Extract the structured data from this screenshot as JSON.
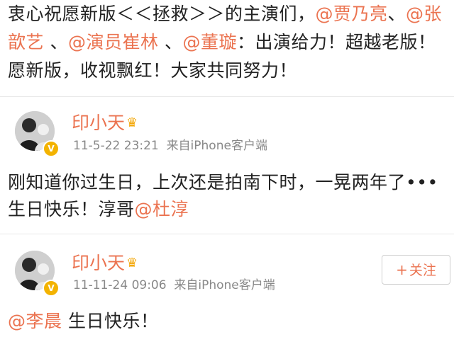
{
  "post_text": {
    "l1_prefix": "衷心祝愿新版＜＜拯救＞＞的主演们，",
    "l1_m1": "@贾乃亮",
    "l1_sep": "、",
    "l1_m2": "@张",
    "l2_m2_cont": "歆艺",
    "l2_sep1": " 、",
    "l2_m3": "@演员崔林",
    "l2_sep2": " 、",
    "l2_m4": "@董璇",
    "l2_suffix": "：出演给力！超越老版！",
    "l3": "愿新版，收视飘红！大家共同努力！"
  },
  "comments": [
    {
      "user": "印小天",
      "crown_icon": "crown-icon",
      "verified_icon": "verified-badge-icon",
      "time": "11-5-22 23:21",
      "source": "来自iPhone客户端",
      "text_line1": "刚知道你过生日，上次还是拍南下时，一晃两年了•••",
      "text_line2_prefix": "生日快乐！淳哥",
      "text_line2_mention": "@杜淳"
    },
    {
      "user": "印小天",
      "crown_icon": "crown-icon",
      "verified_icon": "verified-badge-icon",
      "time": "11-11-24 09:06",
      "source": "来自iPhone客户端",
      "follow_label": "关注",
      "text_mention": "@李晨",
      "text_suffix": " 生日快乐！"
    }
  ],
  "colors": {
    "mention": "#eb7350",
    "meta": "#888888",
    "badge": "#f3b300"
  }
}
